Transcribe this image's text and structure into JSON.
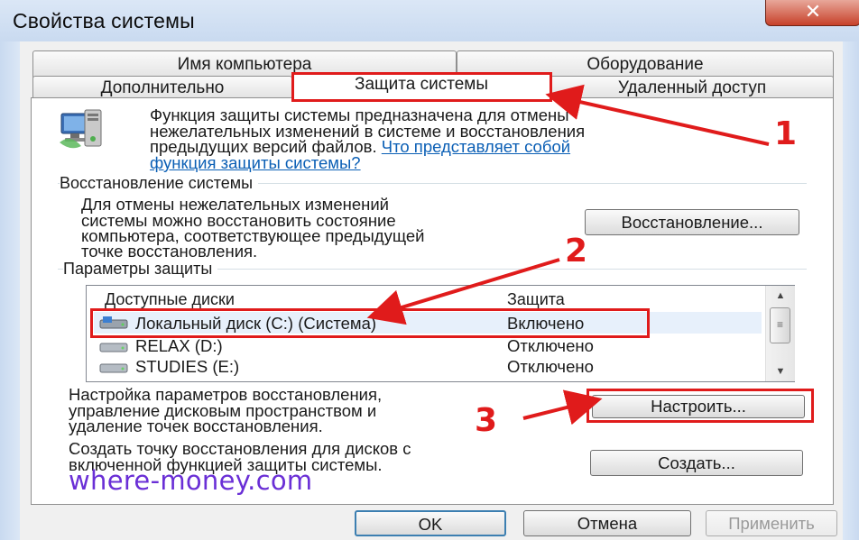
{
  "window": {
    "title": "Свойства системы",
    "close_glyph": "✕"
  },
  "tabs": {
    "row_back": [
      "Имя компьютера",
      "Оборудование"
    ],
    "row_front": [
      "Дополнительно",
      "Защита системы",
      "Удаленный доступ"
    ],
    "active": "Защита системы"
  },
  "intro": {
    "lines": [
      "Функция защиты системы предназначена для отмены",
      "нежелательных изменений в системе и восстановления",
      "предыдущих версий файлов."
    ],
    "link_line1": "Что представляет собой",
    "link_line2": "функция защиты системы?"
  },
  "restore": {
    "group_label": "Восстановление системы",
    "lines": [
      "Для отмены нежелательных изменений",
      "системы можно восстановить состояние",
      "компьютера, соответствующее предыдущей",
      "точке восстановления."
    ],
    "button": "Восстановление..."
  },
  "protection": {
    "group_label": "Параметры защиты",
    "columns": [
      "Доступные диски",
      "Защита"
    ],
    "rows": [
      {
        "drive": "Локальный диск (C:) (Система)",
        "status": "Включено"
      },
      {
        "drive": "RELAX (D:)",
        "status": "Отключено"
      },
      {
        "drive": "STUDIES (E:)",
        "status": "Отключено"
      }
    ],
    "configure_lines": [
      "Настройка параметров восстановления,",
      "управление дисковым пространством и",
      "удаление точек восстановления."
    ],
    "configure_button": "Настроить...",
    "create_lines": [
      "Создать точку восстановления для дисков с",
      "включенной функцией защиты системы."
    ],
    "create_button": "Создать..."
  },
  "footer": {
    "ok": "OK",
    "cancel": "Отмена",
    "apply": "Применить"
  },
  "annotations": {
    "n1": "1",
    "n2": "2",
    "n3": "3",
    "watermark": "where-money.com"
  },
  "colors": {
    "annotation_red": "#e01b1b",
    "link_blue": "#0b5fb5",
    "watermark_purple": "#6a2fd6"
  }
}
